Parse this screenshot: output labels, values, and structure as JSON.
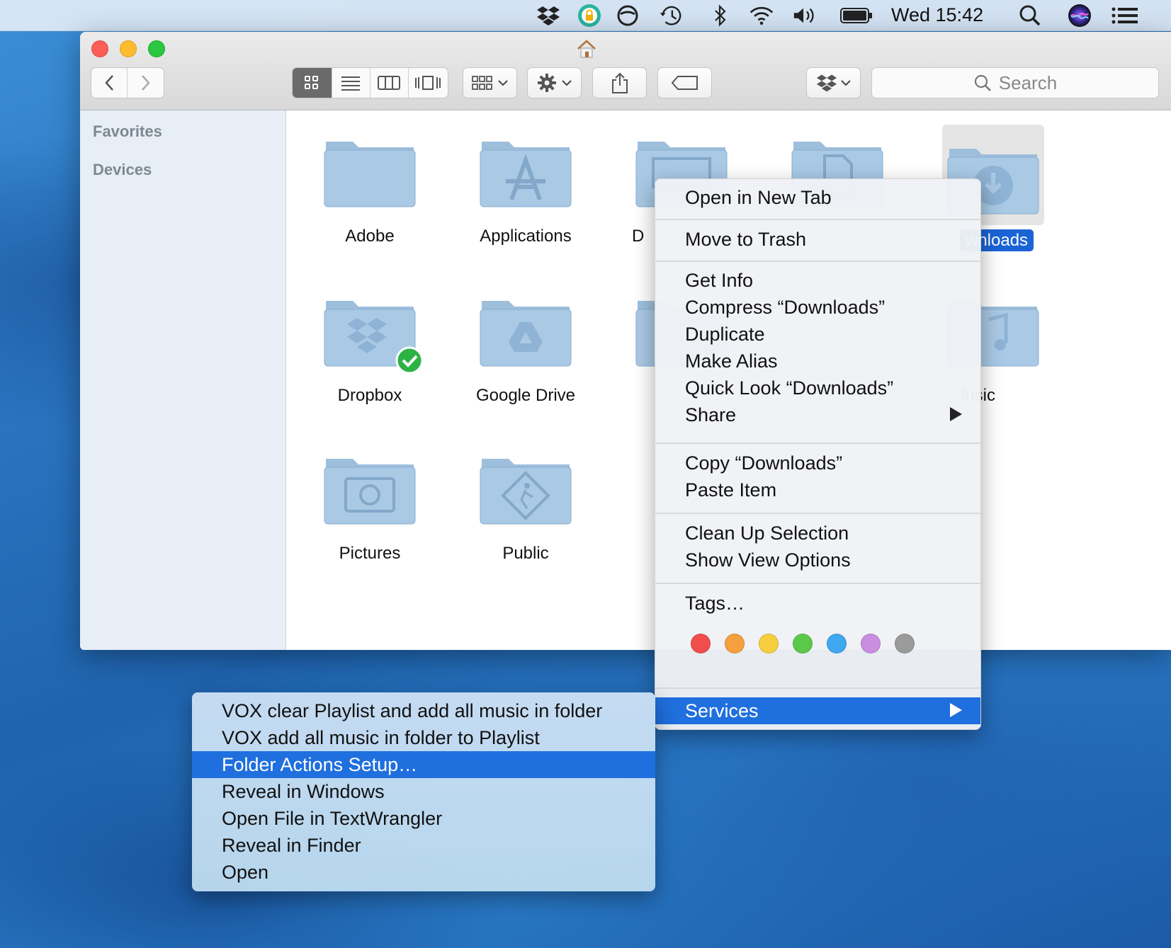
{
  "menubar": {
    "clock": "Wed 15:42",
    "status_icons": [
      "dropbox-icon",
      "vpn-lock-icon",
      "circle-slash-icon",
      "time-machine-icon",
      "bluetooth-icon",
      "wifi-icon",
      "volume-icon",
      "battery-icon",
      "spotlight-icon",
      "siri-icon",
      "notification-center-icon"
    ]
  },
  "window": {
    "title_icon": "home-icon",
    "search": {
      "placeholder": "Search"
    },
    "sidebar": {
      "sections": [
        "Favorites",
        "Devices"
      ]
    },
    "folders": [
      {
        "name": "Adobe",
        "glyph": ""
      },
      {
        "name": "Applications",
        "glyph": "A"
      },
      {
        "name": "D",
        "glyph": ""
      },
      {
        "name": "",
        "glyph": ""
      },
      {
        "name": "wnloads",
        "glyph": "download"
      },
      {
        "name": "Dropbox",
        "glyph": "dropbox"
      },
      {
        "name": "Google Drive",
        "glyph": "drive"
      },
      {
        "name": "lusic",
        "glyph": "music"
      },
      {
        "name": "Pictures",
        "glyph": "camera"
      },
      {
        "name": "Public",
        "glyph": "public"
      }
    ]
  },
  "context_menu": {
    "groups": [
      [
        "Open in New Tab"
      ],
      [
        "Move to Trash"
      ],
      [
        "Get Info",
        "Compress “Downloads”",
        "Duplicate",
        "Make Alias",
        "Quick Look “Downloads”",
        "Share"
      ],
      [
        "Copy “Downloads”",
        "Paste Item"
      ],
      [
        "Clean Up Selection",
        "Show View Options"
      ],
      [
        "Tags…"
      ]
    ],
    "tag_colors": [
      "#f24d4d",
      "#f5a03c",
      "#f7cf3e",
      "#5cc84a",
      "#3fa8f0",
      "#c98ee0",
      "#9b9b9b"
    ],
    "services_label": "Services"
  },
  "services_submenu": {
    "items": [
      "VOX clear Playlist and add all music in folder",
      "VOX add all music in folder to Playlist",
      "Folder Actions Setup…",
      "Reveal in Windows",
      "Open File in TextWrangler",
      "Reveal in Finder",
      "Open"
    ],
    "highlighted_index": 2
  }
}
